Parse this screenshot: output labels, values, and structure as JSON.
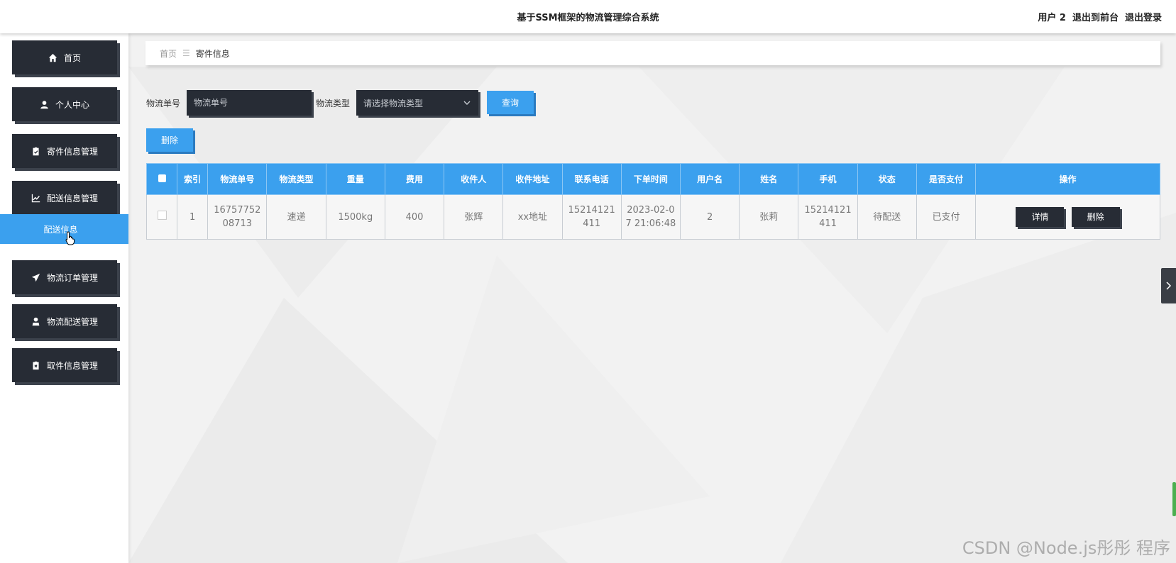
{
  "header": {
    "title": "基于SSM框架的物流管理综合系统",
    "user_label": "用户 2",
    "front_link": "退出到前台",
    "logout_link": "退出登录"
  },
  "sidebar": {
    "items": [
      {
        "label": "首页",
        "icon": "home-icon"
      },
      {
        "label": "个人中心",
        "icon": "user-icon"
      },
      {
        "label": "寄件信息管理",
        "icon": "clipboard-icon"
      },
      {
        "label": "配送信息管理",
        "icon": "chart-icon"
      },
      {
        "label": "物流订单管理",
        "icon": "send-icon"
      },
      {
        "label": "物流配送管理",
        "icon": "person-icon"
      },
      {
        "label": "取件信息管理",
        "icon": "clipboard-x-icon"
      }
    ],
    "active_sub": "配送信息"
  },
  "breadcrumb": {
    "home": "首页",
    "separator": "☰",
    "current": "寄件信息"
  },
  "search": {
    "tracking_label": "物流单号",
    "tracking_placeholder": "物流单号",
    "type_label": "物流类型",
    "type_placeholder": "请选择物流类型",
    "query_button": "查询"
  },
  "actions": {
    "delete_button": "删除"
  },
  "table": {
    "columns": [
      "索引",
      "物流单号",
      "物流类型",
      "重量",
      "费用",
      "收件人",
      "收件地址",
      "联系电话",
      "下单时间",
      "用户名",
      "姓名",
      "手机",
      "状态",
      "是否支付",
      "操作"
    ],
    "rows": [
      {
        "index": "1",
        "tracking_no": "1675775208713",
        "type": "速递",
        "weight": "1500kg",
        "fee": "400",
        "recipient": "张辉",
        "address": "xx地址",
        "contact_phone": "15214121411",
        "order_time": "2023-02-07 21:06:48",
        "username": "2",
        "name": "张莉",
        "mobile": "15214121411",
        "status": "待配送",
        "paid": "已支付",
        "detail_button": "详情",
        "delete_button": "删除"
      }
    ]
  },
  "watermark": "CSDN @Node.js彤彤  程序",
  "colors": {
    "accent": "#3ba0ee",
    "dark": "#272c35"
  }
}
